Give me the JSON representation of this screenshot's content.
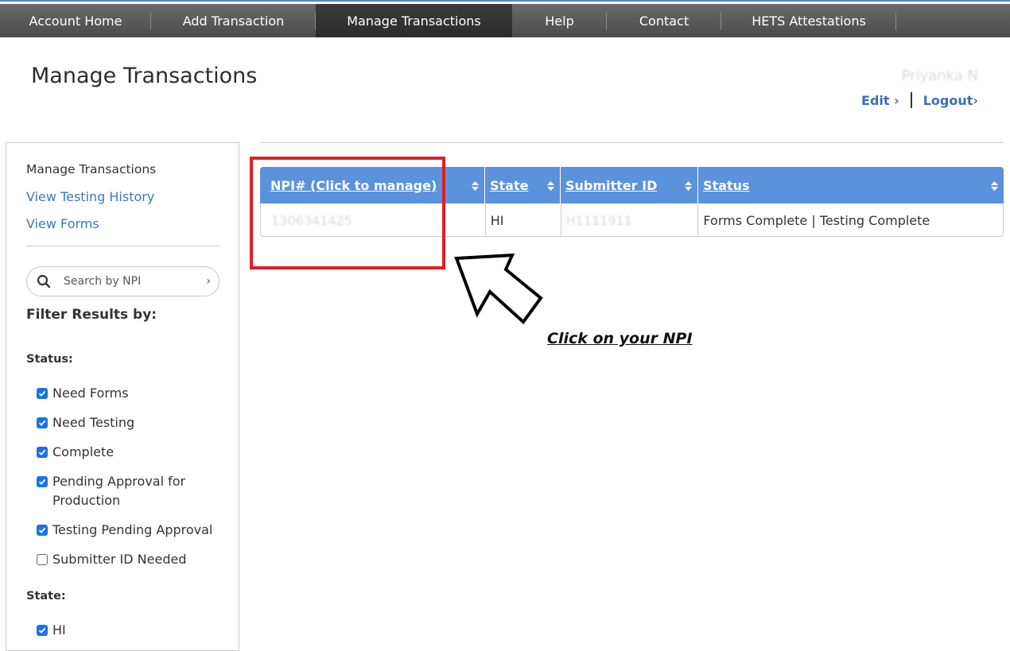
{
  "nav": {
    "items": [
      "Account Home",
      "Add Transaction",
      "Manage Transactions",
      "Help",
      "Contact",
      "HETS Attestations"
    ],
    "active": "Manage Transactions"
  },
  "page": {
    "title": "Manage Transactions"
  },
  "user": {
    "name": "Priyanka N",
    "edit": "Edit ›",
    "logout": "Logout›"
  },
  "sidebar": {
    "title": "Manage Transactions",
    "links": [
      "View Testing History",
      "View Forms"
    ],
    "search_placeholder": "Search by NPI",
    "search_chevron": "›",
    "filter_title": "Filter Results by:",
    "status_label": "Status:",
    "status_options": [
      {
        "label": "Need Forms",
        "checked": true
      },
      {
        "label": "Need Testing",
        "checked": true
      },
      {
        "label": "Complete",
        "checked": true
      },
      {
        "label": "Pending Approval for Production",
        "checked": true
      },
      {
        "label": "Testing Pending Approval",
        "checked": true
      },
      {
        "label": "Submitter ID Needed",
        "checked": false
      }
    ],
    "state_label": "State:",
    "state_options": [
      {
        "label": "HI",
        "checked": true
      }
    ]
  },
  "table": {
    "headers": [
      "NPI# (Click to manage)",
      "State",
      "Submitter ID",
      "Status"
    ],
    "rows": [
      [
        "1306341425",
        "HI",
        "H1111911",
        "Forms Complete | Testing Complete"
      ]
    ]
  },
  "annotation": {
    "instruction": "Click on your NPI",
    "highlight_color": "#dd1f26"
  },
  "colors": {
    "nav_bg": "#555555",
    "header_blue": "#5b92dc",
    "link_blue": "#3c78b8",
    "checkbox_blue": "#1a73e8"
  }
}
